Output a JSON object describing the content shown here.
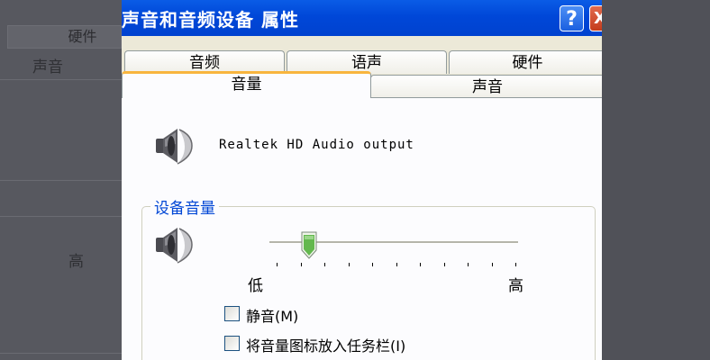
{
  "background_window": {
    "tab_label": "硬件",
    "label_sound": "声音",
    "label_high": "高"
  },
  "dialog": {
    "title": "声音和音频设备 属性",
    "help_button": "?",
    "close_button": "X",
    "tabs_row1": [
      {
        "label": "音频"
      },
      {
        "label": "语声"
      },
      {
        "label": "硬件"
      }
    ],
    "tabs_row2": [
      {
        "label": "音量",
        "active": true
      },
      {
        "label": "声音",
        "active": false
      }
    ],
    "device_name": "Realtek HD Audio output",
    "device_volume": {
      "group_title": "设备音量",
      "low_label": "低",
      "high_label": "高",
      "slider_level_fraction": 0.16
    },
    "checkboxes": [
      {
        "label": "静音(M)",
        "checked": false
      },
      {
        "label": "将音量图标放入任务栏(I)",
        "checked": false
      }
    ]
  },
  "colors": {
    "title_bar": "#0047d8",
    "dialog_face": "#ece9d8",
    "panel": "#fcfcfe",
    "group_title": "#0046d5",
    "active_tab_accent": "#f8b53e"
  },
  "icons": [
    "speaker-icon",
    "help-icon",
    "close-icon"
  ]
}
